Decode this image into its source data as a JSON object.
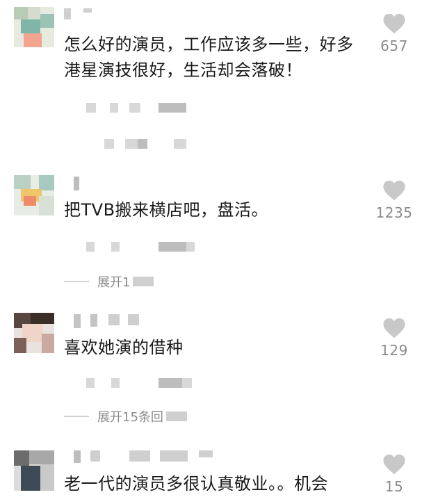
{
  "comments": [
    {
      "text": "怎么好的演员，工作应该多一些，好多港星演技很好，生活却会落破！",
      "likes": "657",
      "expand": ""
    },
    {
      "text": "把TVB搬来横店吧，盘活。",
      "likes": "1235",
      "expand": "展开1"
    },
    {
      "text": "喜欢她演的借种",
      "likes": "129",
      "expand": "展开15条回"
    },
    {
      "text": "老一代的演员多很认真敬业。。机会",
      "likes": "15",
      "expand": ""
    }
  ],
  "icons": {
    "like": "heart-icon"
  },
  "colors": {
    "text": "#1a1a1a",
    "meta": "#8a8a8a",
    "heart": "#c8c8c8"
  }
}
